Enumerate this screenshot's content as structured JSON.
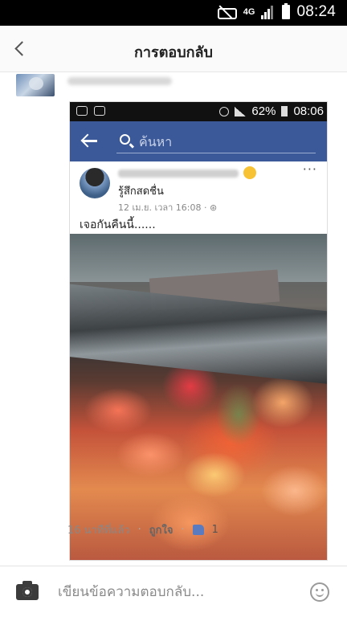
{
  "status_bar": {
    "network": "4G",
    "time": "08:24"
  },
  "header": {
    "title": "การตอบกลับ"
  },
  "attached_screenshot": {
    "status_bar": {
      "battery": "62%",
      "time": "08:06"
    },
    "search_placeholder": "ค้นหา",
    "post": {
      "feeling": "รู้สึกสดชื่น",
      "timestamp": "12 เม.ย. เวลา 16:08 · ",
      "text": "เจอกันคืนนี้......",
      "more": "···"
    }
  },
  "comment_footer": {
    "time_ago": "16 นาทีที่แล้ว",
    "separator": "·",
    "like_label": "ถูกใจ",
    "like_count": "1"
  },
  "reply_bar": {
    "placeholder": "เขียนข้อความตอบกลับ..."
  }
}
